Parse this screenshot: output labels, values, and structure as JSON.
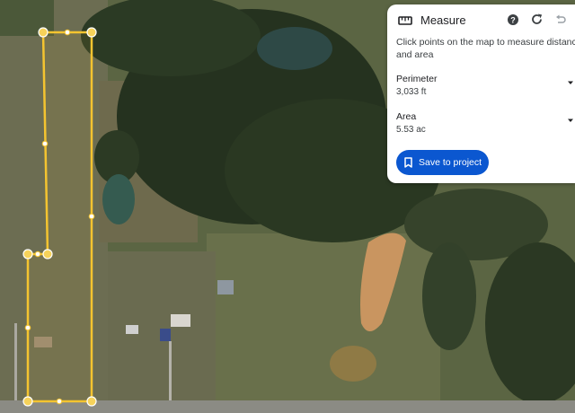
{
  "panel": {
    "title": "Measure",
    "instructions": "Click points on the map to measure distances and area",
    "perimeter": {
      "label": "Perimeter",
      "value": "3,033 ft"
    },
    "area": {
      "label": "Area",
      "value": "5.53 ac"
    },
    "save_label": "Save to project"
  },
  "icons": {
    "title_icon": "ruler-icon",
    "help": "help-icon",
    "reset": "reset-icon",
    "undo": "undo-icon",
    "expand": "chevron-down-icon",
    "save": "bookmark-icon"
  },
  "colors": {
    "accent": "#0b57d0",
    "measure_line": "#f4c430"
  }
}
